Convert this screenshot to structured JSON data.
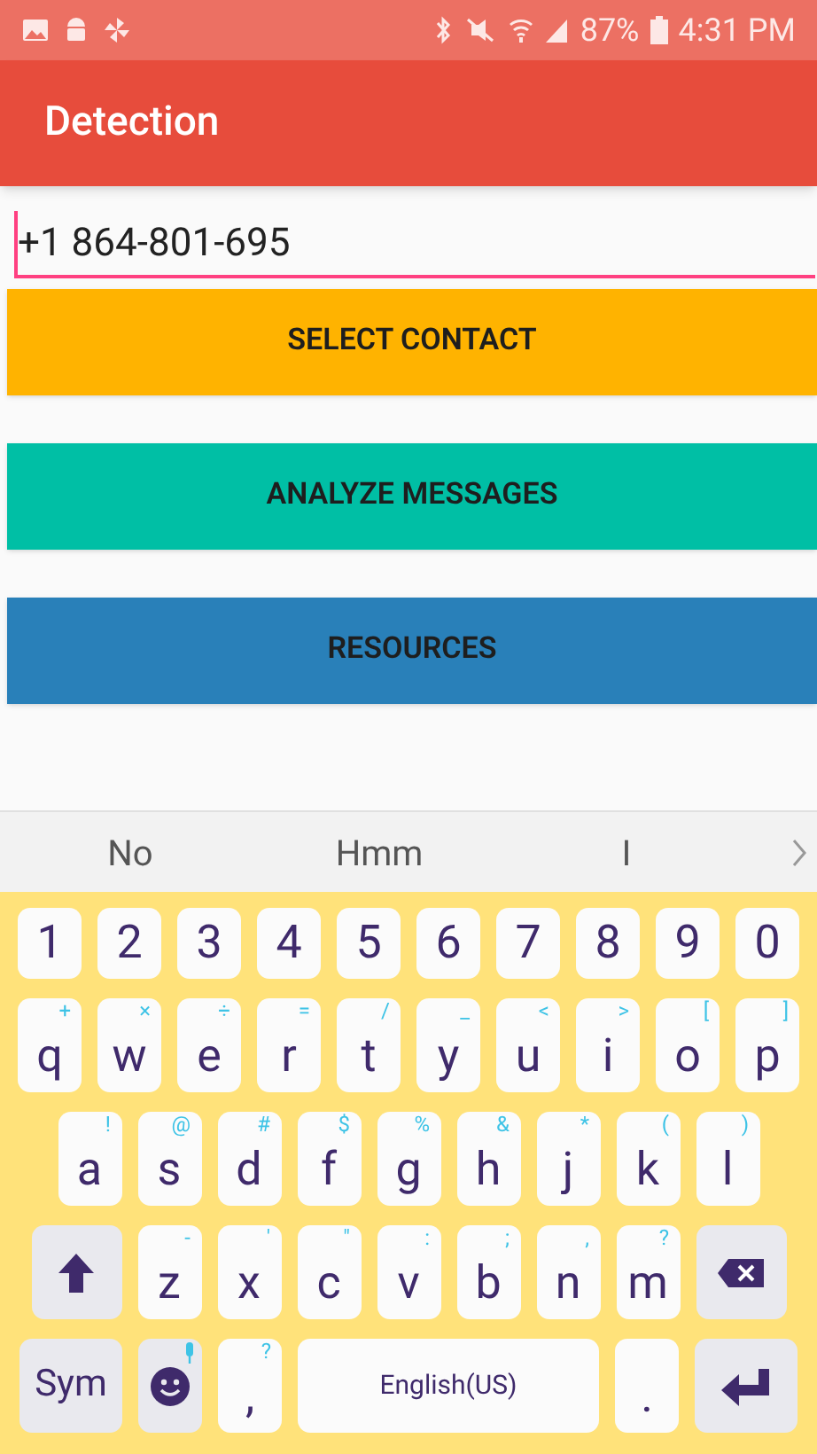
{
  "status_bar": {
    "battery": "87%",
    "time": "4:31 PM"
  },
  "app_bar": {
    "title": "Detection"
  },
  "phone_field": {
    "value": "+1 864-801-695"
  },
  "buttons": [
    {
      "label": "SELECT CONTACT",
      "color": "#ffb300"
    },
    {
      "label": "ANALYZE MESSAGES",
      "color": "#00bfa5"
    },
    {
      "label": "RESOURCES",
      "color": "#2980b9"
    }
  ],
  "suggestions": [
    "No",
    "Hmm",
    "I"
  ],
  "keyboard": {
    "rows": [
      {
        "keys": [
          {
            "kind": "char",
            "label": "1"
          },
          {
            "kind": "char",
            "label": "2"
          },
          {
            "kind": "char",
            "label": "3"
          },
          {
            "kind": "char",
            "label": "4"
          },
          {
            "kind": "char",
            "label": "5"
          },
          {
            "kind": "char",
            "label": "6"
          },
          {
            "kind": "char",
            "label": "7"
          },
          {
            "kind": "char",
            "label": "8"
          },
          {
            "kind": "char",
            "label": "9"
          },
          {
            "kind": "char",
            "label": "0"
          }
        ]
      },
      {
        "keys": [
          {
            "kind": "char",
            "label": "q",
            "hint": "+"
          },
          {
            "kind": "char",
            "label": "w",
            "hint": "×"
          },
          {
            "kind": "char",
            "label": "e",
            "hint": "÷"
          },
          {
            "kind": "char",
            "label": "r",
            "hint": "="
          },
          {
            "kind": "char",
            "label": "t",
            "hint": "/"
          },
          {
            "kind": "char",
            "label": "y",
            "hint": "_"
          },
          {
            "kind": "char",
            "label": "u",
            "hint": "<"
          },
          {
            "kind": "char",
            "label": "i",
            "hint": ">"
          },
          {
            "kind": "char",
            "label": "o",
            "hint": "["
          },
          {
            "kind": "char",
            "label": "p",
            "hint": "]"
          }
        ]
      },
      {
        "keys": [
          {
            "kind": "char",
            "label": "a",
            "hint": "!"
          },
          {
            "kind": "char",
            "label": "s",
            "hint": "@"
          },
          {
            "kind": "char",
            "label": "d",
            "hint": "#"
          },
          {
            "kind": "char",
            "label": "f",
            "hint": "$"
          },
          {
            "kind": "char",
            "label": "g",
            "hint": "%"
          },
          {
            "kind": "char",
            "label": "h",
            "hint": "&"
          },
          {
            "kind": "char",
            "label": "j",
            "hint": "*"
          },
          {
            "kind": "char",
            "label": "k",
            "hint": "("
          },
          {
            "kind": "char",
            "label": "l",
            "hint": ")"
          }
        ]
      },
      {
        "keys": [
          {
            "kind": "shift"
          },
          {
            "kind": "char",
            "label": "z",
            "hint": "-"
          },
          {
            "kind": "char",
            "label": "x",
            "hint": "'"
          },
          {
            "kind": "char",
            "label": "c",
            "hint": "\""
          },
          {
            "kind": "char",
            "label": "v",
            "hint": ":"
          },
          {
            "kind": "char",
            "label": "b",
            "hint": ";"
          },
          {
            "kind": "char",
            "label": "n",
            "hint": ","
          },
          {
            "kind": "char",
            "label": "m",
            "hint": "?"
          },
          {
            "kind": "backspace"
          }
        ]
      },
      {
        "keys": [
          {
            "kind": "sym",
            "label": "Sym"
          },
          {
            "kind": "emoji"
          },
          {
            "kind": "char",
            "label": ",",
            "hint": "?"
          },
          {
            "kind": "space",
            "label": "English(US)"
          },
          {
            "kind": "char",
            "label": "."
          },
          {
            "kind": "enter"
          }
        ]
      }
    ]
  }
}
